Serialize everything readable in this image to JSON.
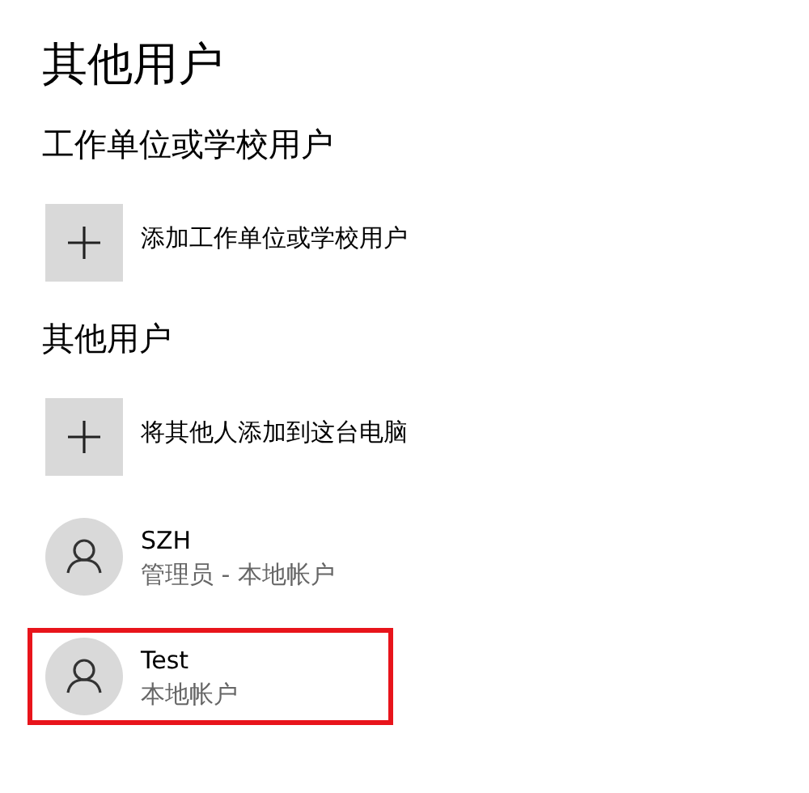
{
  "title": "其他用户",
  "sections": [
    {
      "heading": "工作单位或学校用户",
      "items": [
        {
          "kind": "add",
          "label": "添加工作单位或学校用户",
          "highlighted": false
        }
      ]
    },
    {
      "heading": "其他用户",
      "items": [
        {
          "kind": "add",
          "label": "将其他人添加到这台电脑",
          "highlighted": false
        },
        {
          "kind": "user",
          "label": "SZH",
          "subtitle": "管理员 - 本地帐户",
          "highlighted": false
        },
        {
          "kind": "user",
          "label": "Test",
          "subtitle": "本地帐户",
          "highlighted": true
        }
      ]
    }
  ]
}
